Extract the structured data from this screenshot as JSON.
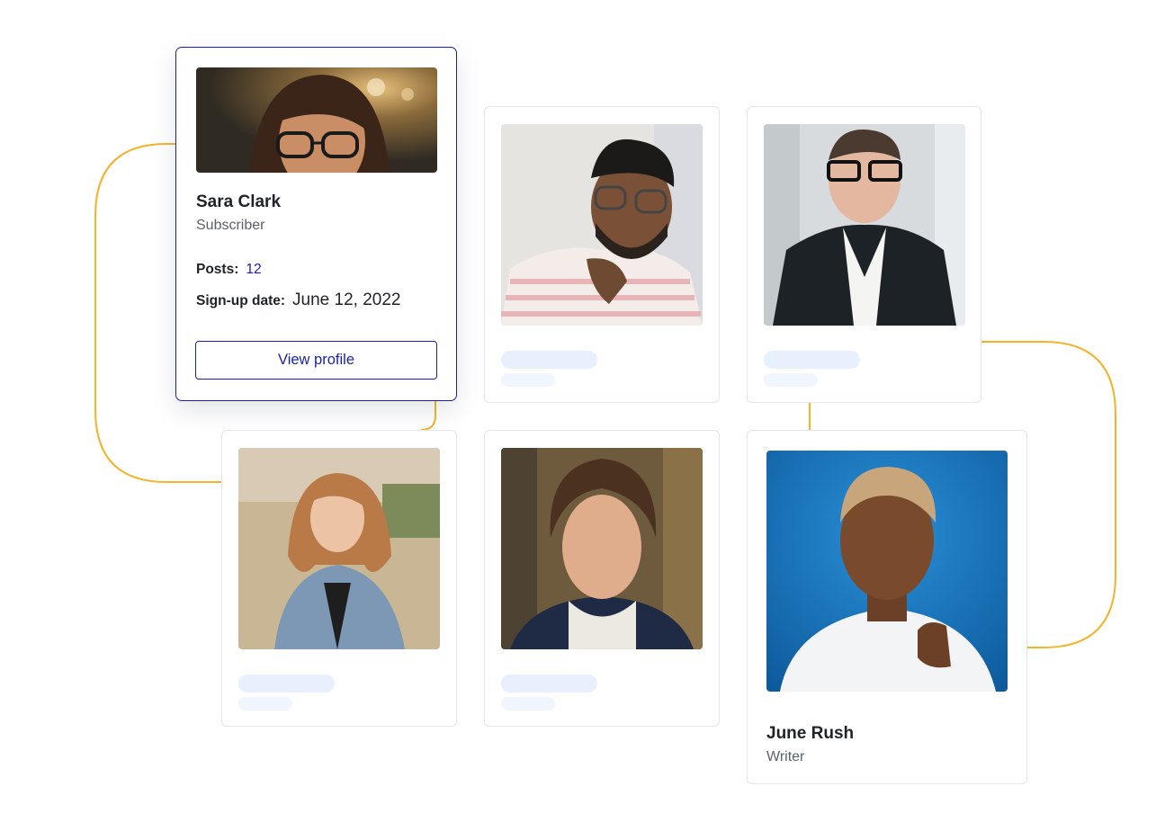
{
  "featured_profile": {
    "name": "Sara Clark",
    "role": "Subscriber",
    "posts_label": "Posts:",
    "posts_value": "12",
    "signup_label": "Sign-up date:",
    "signup_value": "June 12, 2022",
    "button_label": "View profile"
  },
  "highlight_profile": {
    "name": "June Rush",
    "role": "Writer"
  },
  "colors": {
    "accent": "#1a1fa5",
    "connector": "#f5b32a",
    "skeleton": "#e9f0fd"
  }
}
